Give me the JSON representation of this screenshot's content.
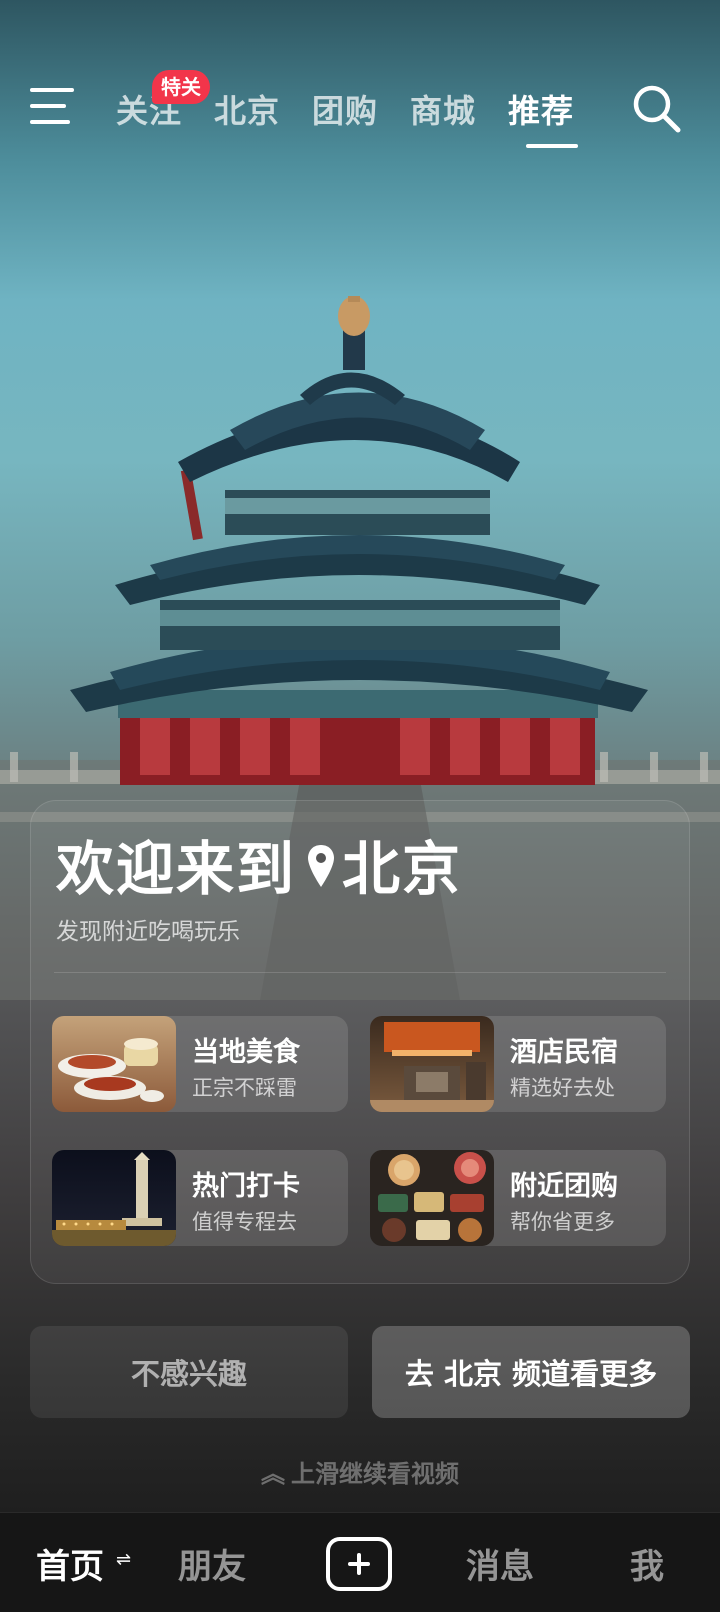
{
  "topnav": {
    "tabs": [
      {
        "label": "关注",
        "badge": "特关"
      },
      {
        "label": "北京"
      },
      {
        "label": "团购"
      },
      {
        "label": "商城"
      },
      {
        "label": "推荐",
        "active": true
      }
    ],
    "menu_icon": "hamburger-menu-icon",
    "search_icon": "search-icon"
  },
  "welcome": {
    "prefix": "欢迎来到",
    "city": "北京",
    "pin_icon": "location-pin-icon",
    "subtitle": "发现附近吃喝玩乐"
  },
  "tiles": [
    {
      "title": "当地美食",
      "subtitle": "正宗不踩雷",
      "image": "food-thumbnail"
    },
    {
      "title": "酒店民宿",
      "subtitle": "精选好去处",
      "image": "hotel-thumbnail"
    },
    {
      "title": "热门打卡",
      "subtitle": "值得专程去",
      "image": "landmark-thumbnail"
    },
    {
      "title": "附近团购",
      "subtitle": "帮你省更多",
      "image": "group-buy-thumbnail"
    }
  ],
  "actions": {
    "not_interested": "不感兴趣",
    "go_channel": "去 北京 频道看更多"
  },
  "swipe_hint": "上滑继续看视频",
  "bottom_nav": {
    "home": "首页",
    "friends": "朋友",
    "create_icon": "plus-icon",
    "messages": "消息",
    "me": "我"
  },
  "colors": {
    "badge": "#f2354a",
    "sky_top": "#2e5661",
    "sky_mid": "#6fb3c2"
  }
}
